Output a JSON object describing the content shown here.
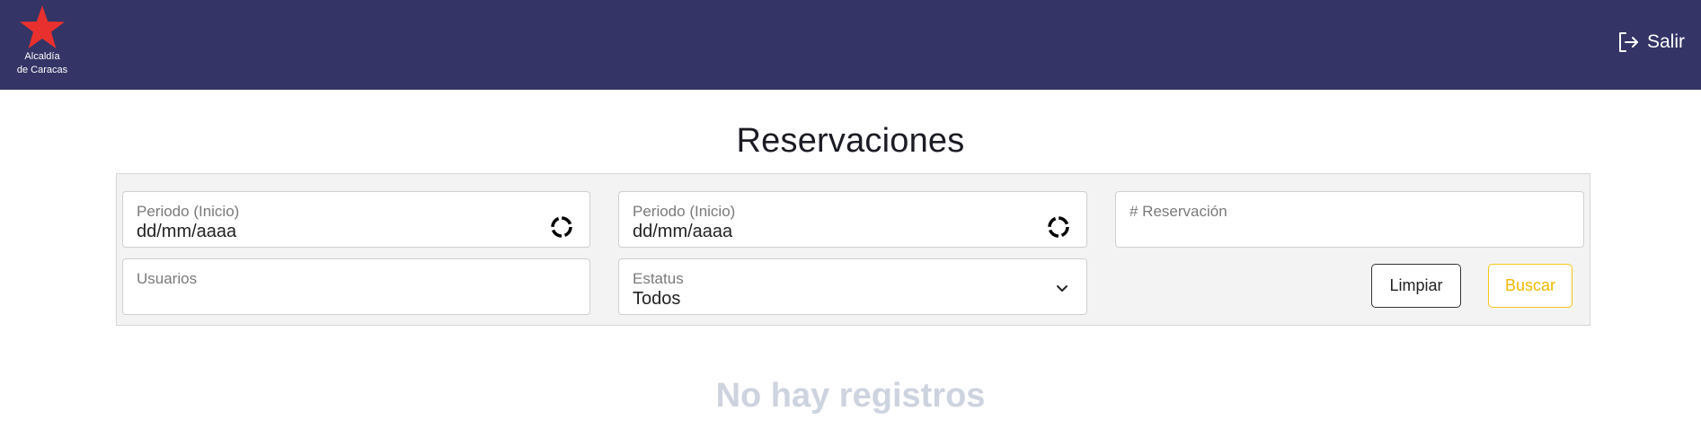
{
  "header": {
    "logo_line1": "Alcaldía",
    "logo_line2": "de Caracas",
    "logout_label": "Salir",
    "logo_star_color": "#e8312f",
    "bar_color": "#343466"
  },
  "page": {
    "title": "Reservaciones",
    "empty_message": "No hay registros"
  },
  "filters": {
    "start_date": {
      "label": "Periodo (Inicio)",
      "value": "dd/mm/aaaa",
      "icon": "calendar-clock-icon"
    },
    "end_date": {
      "label": "Periodo (Inicio)",
      "value": "dd/mm/aaaa",
      "icon": "calendar-clock-icon"
    },
    "reservation_number": {
      "label": "# Reservación",
      "value": ""
    },
    "users": {
      "label": "Usuarios",
      "value": ""
    },
    "status": {
      "label": "Estatus",
      "value": "Todos",
      "icon": "chevron-down-icon"
    }
  },
  "actions": {
    "clear_label": "Limpiar",
    "search_label": "Buscar",
    "search_color": "#f0b800"
  }
}
